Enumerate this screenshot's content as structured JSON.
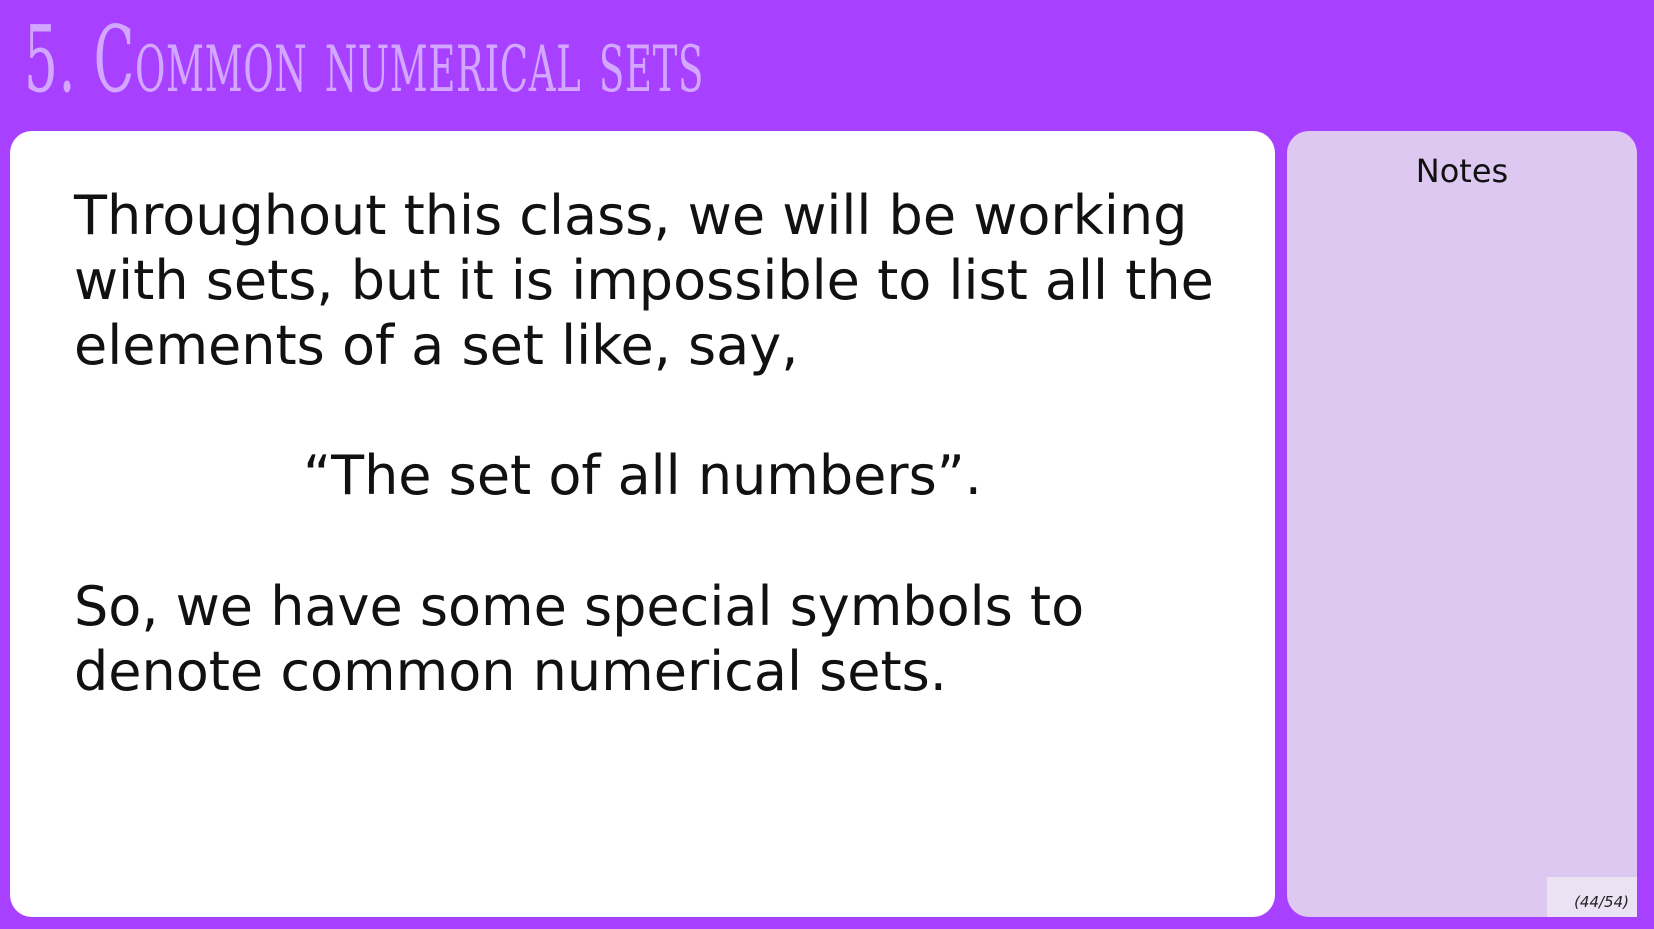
{
  "slide": {
    "title": "5. Common numerical sets",
    "paragraph_1": "Throughout this class, we will be working with sets, but it is impossible to list all the elements of a set like, say,",
    "quote": "“The set of all numbers”.",
    "paragraph_2": "So, we have some special symbols to denote common numerical sets."
  },
  "notes": {
    "title": "Notes"
  },
  "footer": {
    "page_number": "(44/54)"
  },
  "colors": {
    "background": "#a840ff",
    "title_text": "#d3a6ff",
    "main_panel": "#ffffff",
    "notes_panel": "#dcc8f0"
  }
}
